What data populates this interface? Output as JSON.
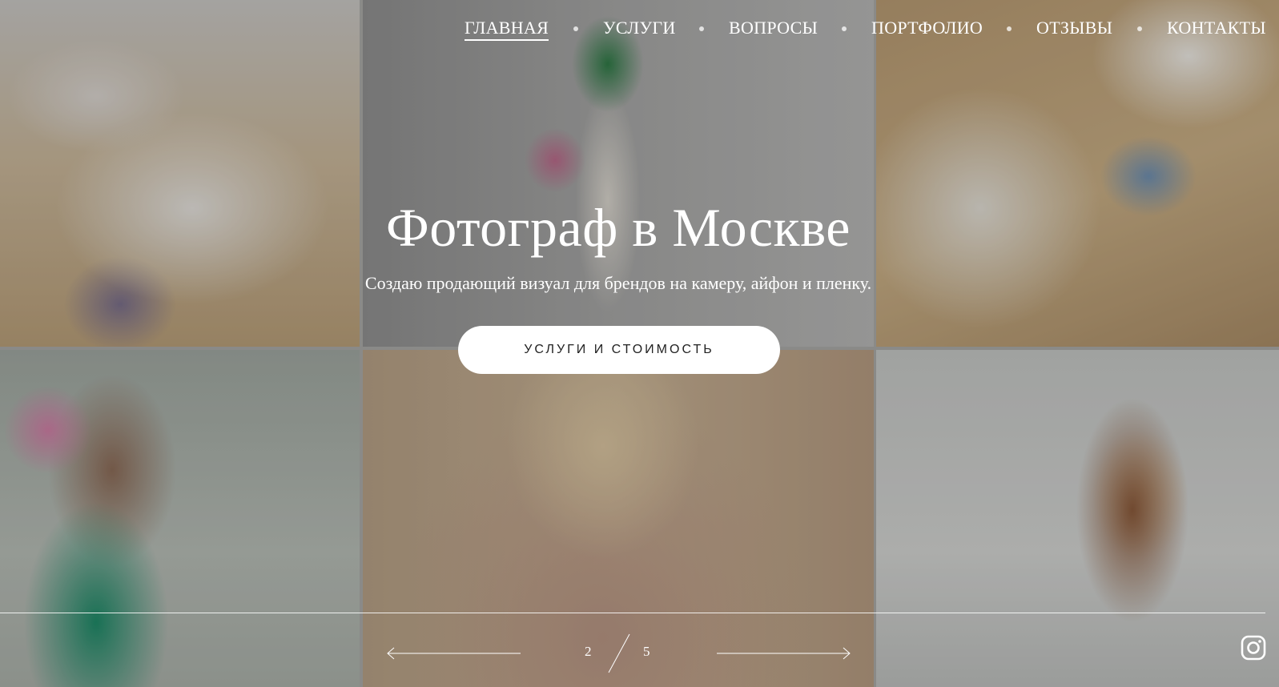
{
  "nav": {
    "items": [
      {
        "label": "ГЛАВНАЯ",
        "active": true
      },
      {
        "label": "УСЛУГИ",
        "active": false
      },
      {
        "label": "ВОПРОСЫ",
        "active": false
      },
      {
        "label": "ПОРТФОЛИО",
        "active": false
      },
      {
        "label": "ОТЗЫВЫ",
        "active": false
      },
      {
        "label": "КОНТАКТЫ",
        "active": false
      }
    ]
  },
  "hero": {
    "title": "Фотограф в Москве",
    "subtitle": "Создаю продающий визуал для брендов на камеру, айфон и пленку.",
    "cta_label": "УСЛУГИ И СТОИМОСТЬ"
  },
  "slider": {
    "current": "2",
    "total": "5",
    "prev_icon": "arrow-left-icon",
    "next_icon": "arrow-right-icon"
  },
  "social": {
    "icon": "instagram-icon"
  },
  "colors": {
    "text": "#ffffff",
    "button_bg": "#ffffff",
    "button_text": "#222222"
  }
}
